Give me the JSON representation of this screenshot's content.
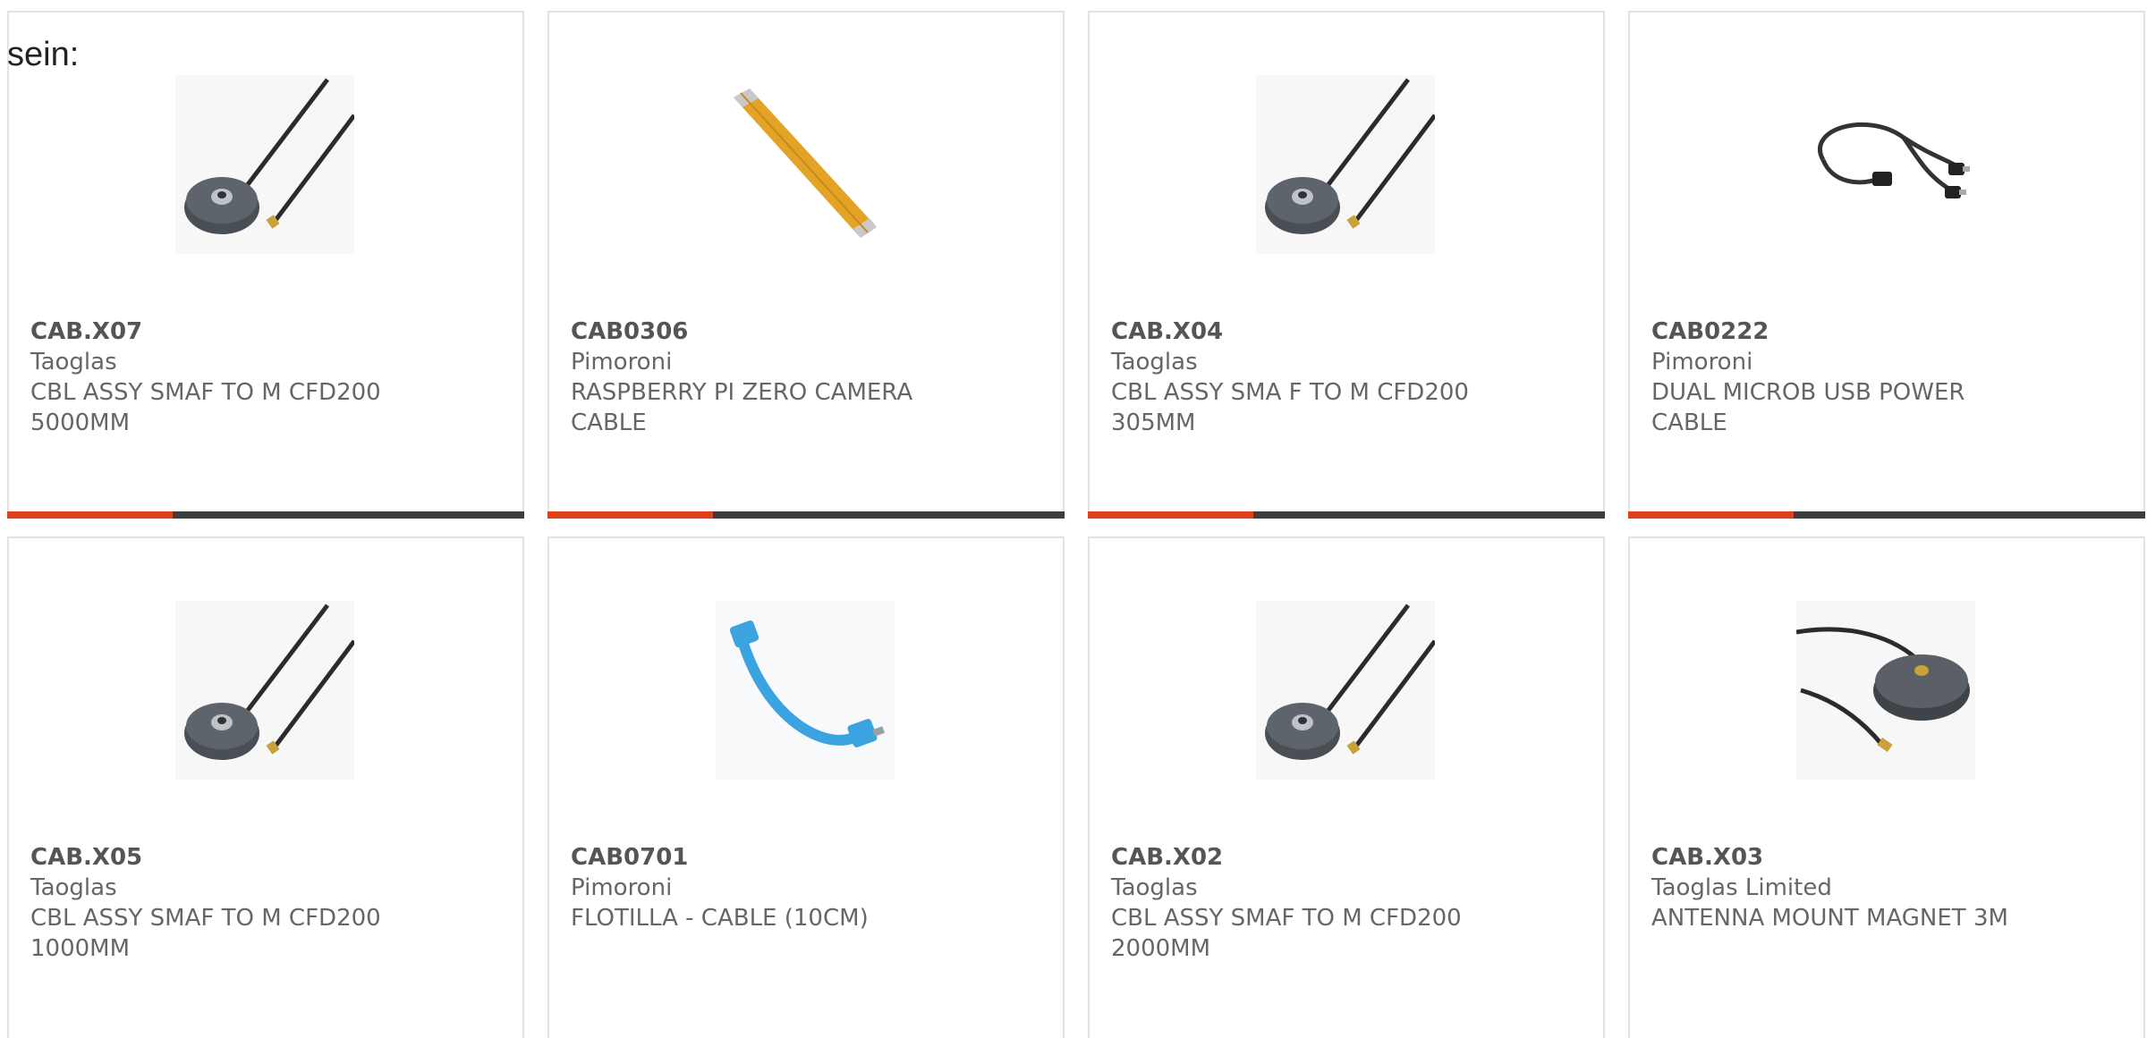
{
  "intro": {
    "text": "sein:"
  },
  "colors": {
    "accent": "#e0401c",
    "bar_track": "#3d3d3d",
    "card_border": "#e3e3e3",
    "text": "#666666"
  },
  "products": [
    {
      "part": "CAB.X07",
      "manufacturer": "Taoglas",
      "description": "CBL ASSY SMAF TO M CFD200 5000MM",
      "image": "magnet-mount-antenna-cable",
      "progress": 0.32
    },
    {
      "part": "CAB0306",
      "manufacturer": "Pimoroni",
      "description": "RASPBERRY PI ZERO CAMERA CABLE",
      "image": "ribbon-cable",
      "progress": 0.32
    },
    {
      "part": "CAB.X04",
      "manufacturer": "Taoglas",
      "description": "CBL ASSY SMA F TO M CFD200 305MM",
      "image": "magnet-mount-antenna-cable",
      "progress": 0.32
    },
    {
      "part": "CAB0222",
      "manufacturer": "Pimoroni",
      "description": "DUAL MICROB USB POWER CABLE",
      "image": "dual-usb-cable",
      "progress": 0.32
    },
    {
      "part": "CAB.X05",
      "manufacturer": "Taoglas",
      "description": "CBL ASSY SMAF TO M CFD200 1000MM",
      "image": "magnet-mount-antenna-cable",
      "progress": null
    },
    {
      "part": "CAB0701",
      "manufacturer": "Pimoroni",
      "description": "FLOTILLA - CABLE (10CM)",
      "image": "blue-usb-cable",
      "progress": null
    },
    {
      "part": "CAB.X02",
      "manufacturer": "Taoglas",
      "description": "CBL ASSY SMAF TO M CFD200 2000MM",
      "image": "magnet-mount-antenna-cable",
      "progress": null
    },
    {
      "part": "CAB.X03",
      "manufacturer": "Taoglas Limited",
      "description": "ANTENNA MOUNT MAGNET 3M",
      "image": "antenna-mount-magnet",
      "progress": null
    }
  ]
}
